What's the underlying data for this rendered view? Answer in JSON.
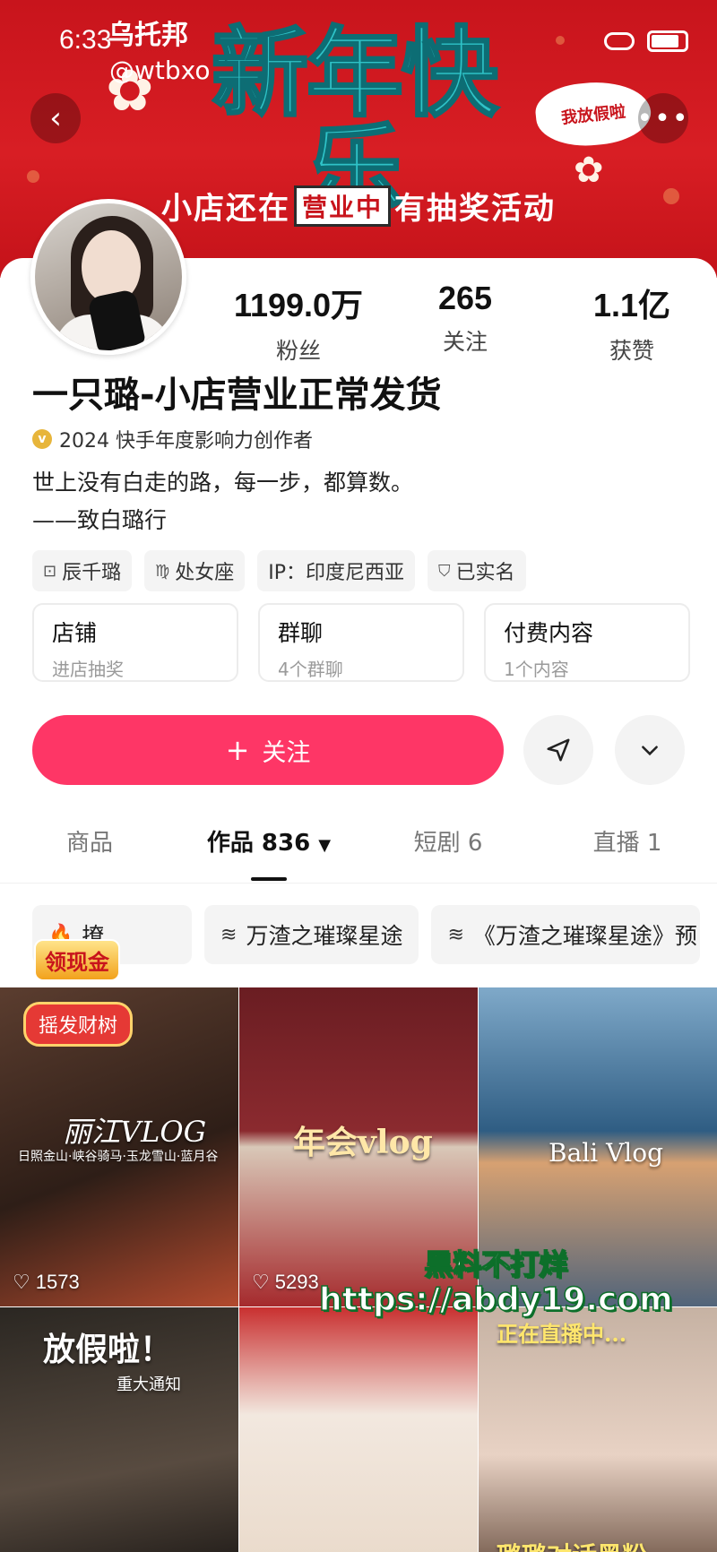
{
  "status_bar": {
    "time": "6:33"
  },
  "watermark": {
    "name": "乌托邦",
    "handle": "@wtbxo"
  },
  "banner": {
    "title": "新年快乐",
    "subtitle_pre": "小店还在",
    "subtitle_tag": "营业中",
    "subtitle_post": "有抽奖活动",
    "badge": "我放假啦"
  },
  "stats": [
    {
      "value": "1199.0万",
      "label": "粉丝"
    },
    {
      "value": "265",
      "label": "关注"
    },
    {
      "value": "1.1亿",
      "label": "获赞"
    }
  ],
  "profile": {
    "nickname": "一只璐-小店营业正常发货",
    "certification": "2024 快手年度影响力创作者",
    "bio_line1": "世上没有白走的路，每一步，都算数。",
    "bio_line2": "——致白璐行"
  },
  "tags": [
    {
      "icon": "shop-icon",
      "label": "辰千璐"
    },
    {
      "icon": "zodiac-icon",
      "label": "处女座"
    },
    {
      "icon": "",
      "label": "IP：印度尼西亚"
    },
    {
      "icon": "verified-icon",
      "label": "已实名"
    }
  ],
  "features": [
    {
      "title": "店铺",
      "sub": "进店抽奖"
    },
    {
      "title": "群聊",
      "sub": "4个群聊"
    },
    {
      "title": "付费内容",
      "sub": "1个内容"
    }
  ],
  "follow_button": {
    "label": "关注"
  },
  "tabs": [
    {
      "label": "商品"
    },
    {
      "label": "作品 836"
    },
    {
      "label": "短剧 6"
    },
    {
      "label": "直播 1"
    }
  ],
  "collections": [
    {
      "label": "撩"
    },
    {
      "label": "万渣之璀璨星途"
    },
    {
      "label": "《万渣之璀璨星途》预"
    }
  ],
  "grid": [
    {
      "overlay": "丽江VLOG",
      "caption": "日照金山·峡谷骑马·玉龙雪山·蓝月谷",
      "likes": "1573",
      "badge_gold": "领现金",
      "badge_red": "摇发财树"
    },
    {
      "overlay": "年会vlog",
      "likes": "5293"
    },
    {
      "overlay": "Bali Vlog"
    },
    {
      "overlay": "放假啦！",
      "caption": "重大通知"
    },
    {
      "overlay": ""
    },
    {
      "overlay": "正在直播中...",
      "caption": "璐璐对话黑粉"
    }
  ],
  "promo": {
    "line1": "黑料不打烊",
    "line2": "https://abdy19.com"
  },
  "colors": {
    "accent": "#fe3666",
    "banner_red": "#c8141c",
    "banner_title": "#2fc3c8"
  }
}
